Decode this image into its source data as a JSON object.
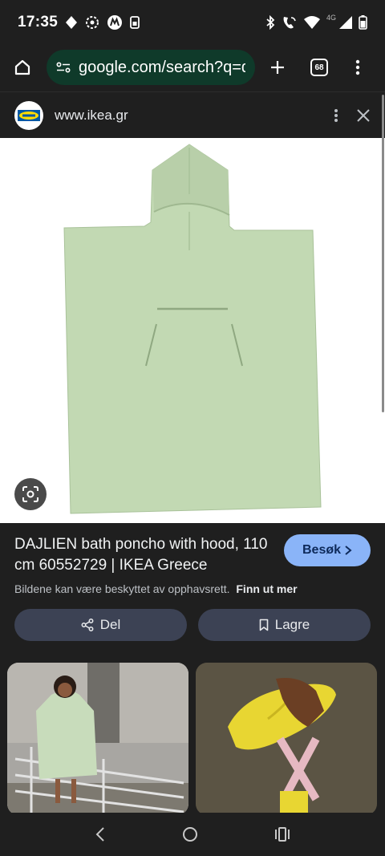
{
  "status_bar": {
    "time": "17:35",
    "network": "4G",
    "icons": [
      "navigation-icon",
      "settings-icon",
      "motorola-icon",
      "sim-icon",
      "bluetooth-icon",
      "wifi-calling-icon",
      "wifi-icon",
      "signal-icon",
      "battery-icon"
    ]
  },
  "browser": {
    "url": "google.com/search?q=d",
    "tab_count": "68",
    "icons": [
      "home-icon",
      "site-info-icon",
      "new-tab-icon",
      "tabs-icon",
      "more-vert-icon"
    ]
  },
  "sheet": {
    "site": "www.ikea.gr",
    "icons": [
      "ikea-logo-icon",
      "more-vert-icon",
      "close-icon"
    ]
  },
  "result": {
    "title": "DAJLIEN bath poncho with hood, 110 cm 60552729 | IKEA Greece",
    "visit_label": "Besøk",
    "copyright_text": "Bildene kan være beskyttet av opphavsrett.",
    "learn_more": "Finn ut mer",
    "share_label": "Del",
    "save_label": "Lagre"
  },
  "colors": {
    "accent": "#8ab4f8",
    "omnibox": "#0f3a2a",
    "poncho": "#c2d9b3",
    "background": "#1f1f1f"
  }
}
